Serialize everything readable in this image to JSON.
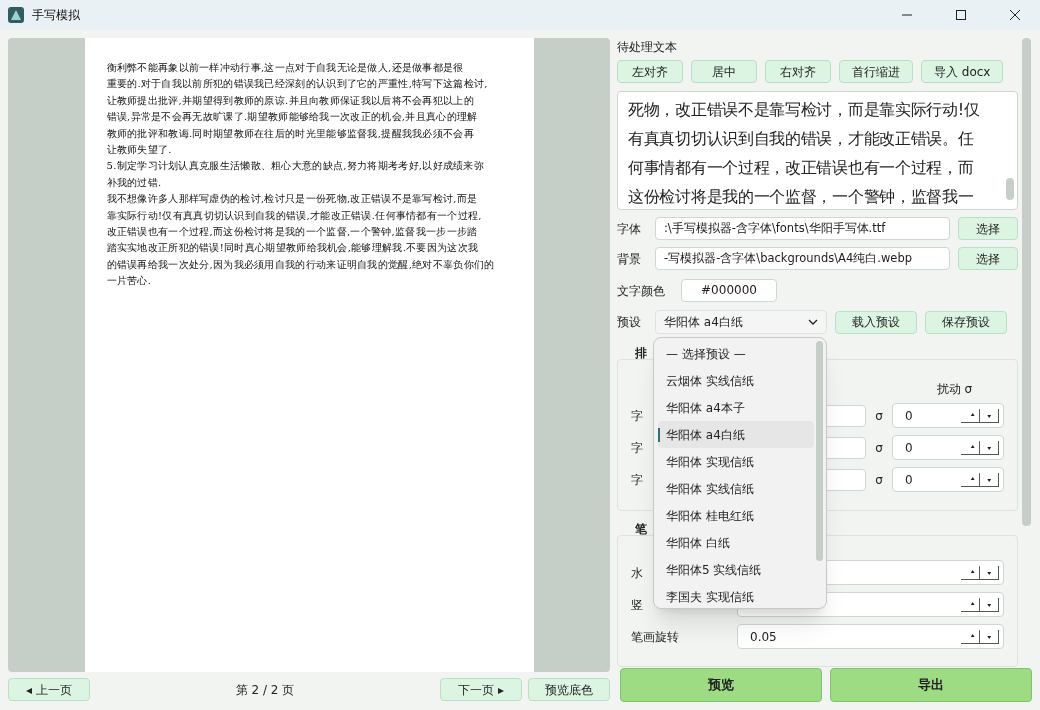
{
  "window": {
    "title": "手写模拟"
  },
  "preview": {
    "lines": [
      "衡利弊不能再象以前一样冲动行事,这一点对于自我无论是做人,还是做事都是很",
      "重要的.对于自我以前所犯的错误我已经深刻的认识到了它的严重性,特写下这篇检讨,",
      "让教师提出批评,并期望得到教师的原谅.并且向教师保证我以后将不会再犯以上的",
      "错误,异常是不会再无故旷课了.期望教师能够给我一次改正的机会,并且真心的理解",
      "教师的批评和教诲.同时期望教师在往后的时光里能够监督我,提醒我我必须不会再",
      "让教师失望了.",
      "5.制定学习计划认真克服生活懒散、粗心大意的缺点,努力将期考考好,以好成绩来弥",
      "补我的过错.",
      "我不想像许多人那样写虚伪的检讨,检讨只是一份死物,改正错误不是靠写检讨,而是",
      "靠实际行动!仅有真真切切认识到自我的错误,才能改正错误.任何事情都有一个过程,",
      "改正错误也有一个过程,而这份检讨将是我的一个监督,一个警钟,监督我一步一步踏",
      "踏实实地改正所犯的错误!同时真心期望教师给我机会,能够理解我.不要因为这次我",
      "的错误再给我一次处分,因为我必须用自我的行动来证明自我的觉醒,绝对不辜负你们的",
      "一片苦心."
    ]
  },
  "pager": {
    "prev": "◂ 上一页",
    "page": "第 2 / 2 页",
    "next": "下一页 ▸",
    "bg_button": "预览底色"
  },
  "text_section": {
    "label": "待处理文本",
    "buttons": [
      "左对齐",
      "居中",
      "右对齐",
      "首行缩进",
      "导入 docx"
    ],
    "text_lines": [
      "死物，改正错误不是靠写检讨，而是靠实际行动!仅",
      "有真真切切认识到自我的错误，才能改正错误。任",
      "何事情都有一个过程，改正错误也有一个过程，而",
      "这份检讨将是我的一个监督，一个警钟，监督我一"
    ]
  },
  "files": [
    {
      "label": "字体",
      "value": ":\\手写模拟器-含字体\\fonts\\华阳手写体.ttf",
      "button": "选择"
    },
    {
      "label": "背景",
      "value": "-写模拟器-含字体\\backgrounds\\A4纯白.webp",
      "button": "选择"
    }
  ],
  "text_color": {
    "label": "文字颜色",
    "value": "#000000"
  },
  "preset": {
    "label": "预设",
    "value": "华阳体 a4白纸",
    "load": "载入预设",
    "save": "保存预设"
  },
  "layout_group": {
    "title": "排",
    "jitter_header": "扰动 σ",
    "rows": [
      {
        "label": "字",
        "sigma": "σ",
        "jitter": "0"
      },
      {
        "label": "字",
        "sigma": "σ",
        "jitter": "0"
      },
      {
        "label": "字",
        "sigma": "σ",
        "jitter": "0"
      }
    ]
  },
  "stroke_group": {
    "title": "笔",
    "rows": [
      {
        "label": "水",
        "value": ""
      },
      {
        "label": "竖",
        "value": ""
      },
      {
        "label": "笔画旋转",
        "value": "0.05"
      }
    ]
  },
  "actions": [
    "预览",
    "导出"
  ],
  "dropdown": {
    "items": [
      {
        "label": "— 选择预设 —",
        "selected": false
      },
      {
        "label": "云烟体 实线信纸",
        "selected": false
      },
      {
        "label": "华阳体 a4本子",
        "selected": false
      },
      {
        "label": "华阳体 a4白纸",
        "selected": true
      },
      {
        "label": "华阳体 实现信纸",
        "selected": false
      },
      {
        "label": "华阳体 实线信纸",
        "selected": false
      },
      {
        "label": "华阳体 桂电红纸",
        "selected": false
      },
      {
        "label": "华阳体 白纸",
        "selected": false
      },
      {
        "label": "华阳体5 实线信纸",
        "selected": false
      },
      {
        "label": "李国夫 实现信纸",
        "selected": false
      }
    ]
  }
}
